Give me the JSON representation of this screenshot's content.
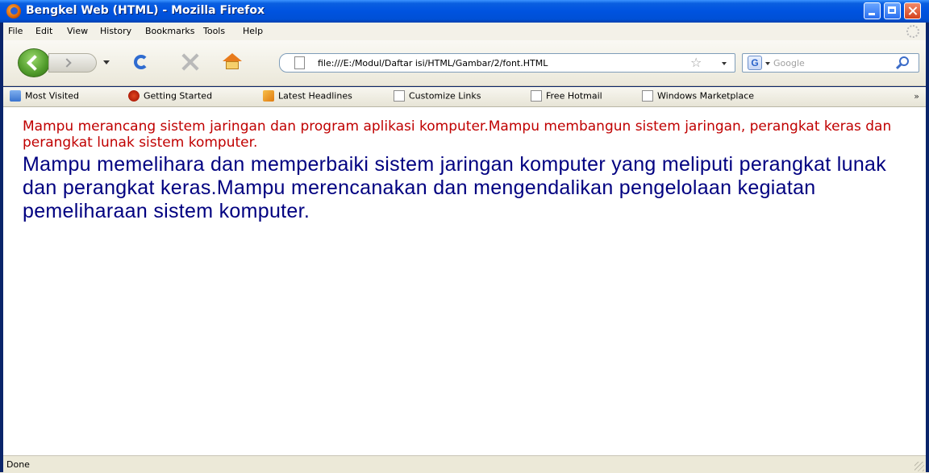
{
  "window": {
    "title": "Bengkel Web (HTML) - Mozilla Firefox"
  },
  "menu": {
    "items": [
      "File",
      "Edit",
      "View",
      "History",
      "Bookmarks",
      "Tools",
      "Help"
    ]
  },
  "nav": {
    "url": "file:///E:/Modul/Daftar isi/HTML/Gambar/2/font.HTML",
    "search_placeholder": "Google",
    "search_engine_letter": "G"
  },
  "bookmarks": {
    "items": [
      {
        "label": "Most Visited",
        "icon": "folder-icon"
      },
      {
        "label": "Getting Started",
        "icon": "firefox-icon"
      },
      {
        "label": "Latest Headlines",
        "icon": "rss-icon"
      },
      {
        "label": "Customize Links",
        "icon": "page-icon"
      },
      {
        "label": "Free Hotmail",
        "icon": "page-icon"
      },
      {
        "label": "Windows Marketplace",
        "icon": "page-icon"
      }
    ],
    "overflow": "»"
  },
  "content": {
    "paragraph_red": "Mampu merancang sistem jaringan dan program aplikasi komputer.Mampu membangun sistem jaringan, perangkat keras dan perangkat lunak sistem komputer.",
    "paragraph_blue": "Mampu memelihara dan memperbaiki sistem jaringan komputer yang meliputi perangkat lunak dan perangkat keras.Mampu merencanakan dan mengendalikan pengelolaan kegiatan pemeliharaan sistem komputer.",
    "colors": {
      "red_text": "#c00000",
      "blue_text": "#000080"
    }
  },
  "status": {
    "text": "Done"
  }
}
